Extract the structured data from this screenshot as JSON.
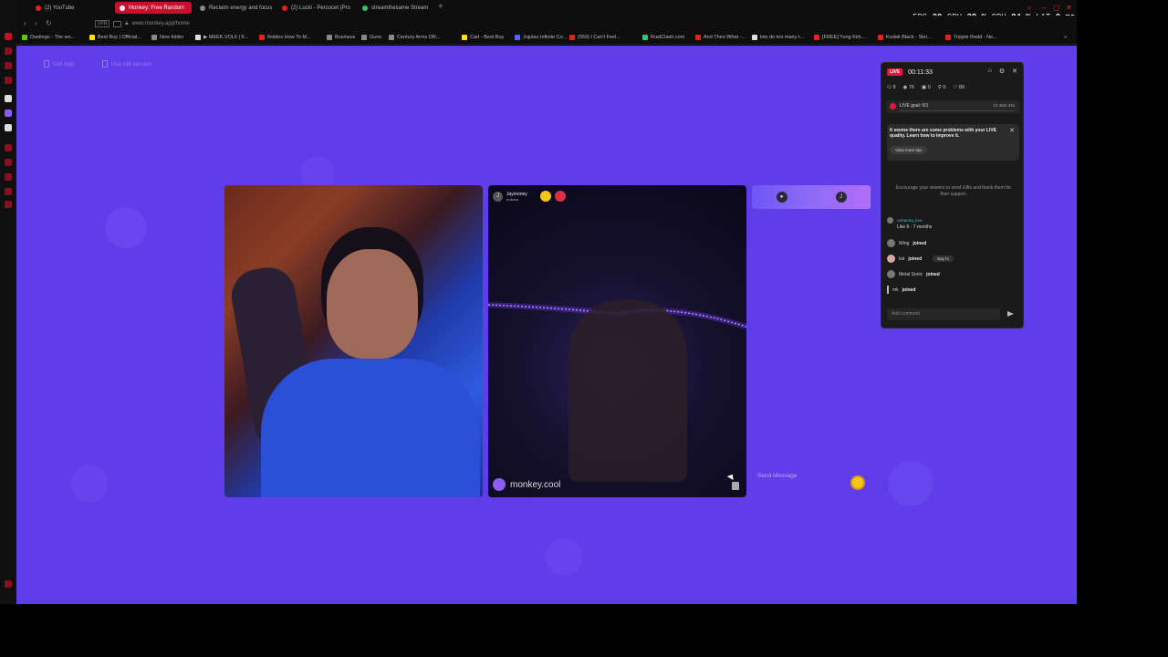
{
  "tabs": [
    {
      "label": "(2) YouTube",
      "active": false,
      "icon_color": "#e62117"
    },
    {
      "label": "Monkey: Free Random",
      "active": true,
      "icon_color": "#ffffff"
    },
    {
      "label": "Reclaim energy and focus",
      "active": false,
      "icon_color": "#888888"
    },
    {
      "label": "(2) Lucki - Percocet (Pro",
      "active": false,
      "icon_color": "#e62117"
    },
    {
      "label": "streamthesame Stream",
      "active": false,
      "icon_color": "#31c46a"
    }
  ],
  "hud": {
    "fps_label": "FPS",
    "fps": "30",
    "gpu_label": "GPU",
    "gpu": "38 %",
    "cpu_label": "CPU",
    "cpu": "24 %",
    "lat_label": "LAT",
    "lat": "0 ms"
  },
  "address": {
    "vpn": "VPN",
    "url": "www.monkey.app/home"
  },
  "bookmarks": [
    {
      "label": "Duolingo - The wo...",
      "color": "#58cc02"
    },
    {
      "label": "Best Buy | Official...",
      "color": "#ffe000"
    },
    {
      "label": "New folder",
      "color": "#888888"
    },
    {
      "label": "▶ MEEK.VOL6 | K...",
      "color": "#dddddd"
    },
    {
      "label": "Roblox How To M...",
      "color": "#e62117"
    },
    {
      "label": "Business",
      "color": "#888888"
    },
    {
      "label": "Guns",
      "color": "#888888"
    },
    {
      "label": "Century Arms DR...",
      "color": "#888888"
    },
    {
      "label": "Cart - Best Buy",
      "color": "#ffe000"
    },
    {
      "label": "Jujutsu Infinite Co...",
      "color": "#5865f2"
    },
    {
      "label": "(559) I Can't Feel...",
      "color": "#e62117"
    },
    {
      "label": "RustClash.com",
      "color": "#31c46a"
    },
    {
      "label": "And Then What -...",
      "color": "#e62117"
    },
    {
      "label": "lets do too many t...",
      "color": "#dddddd"
    },
    {
      "label": "[FREE] Yung Kirk...",
      "color": "#e62117"
    },
    {
      "label": "Kodak Black - Skri...",
      "color": "#e62117"
    },
    {
      "label": "Trippie Redd - Ne...",
      "color": "#e62117"
    }
  ],
  "topnav": {
    "get_app": "Get App",
    "old_version": "Use old version"
  },
  "stranger": {
    "name": "Jaymoney",
    "sub": "Indiana",
    "initial": "J"
  },
  "watermark": "monkey.cool",
  "chat": {
    "placeholder": "Send Message",
    "initial": "J"
  },
  "live": {
    "badge": "LIVE",
    "timer": "00:11:33",
    "stats": [
      {
        "icon": "users-icon",
        "value": "9"
      },
      {
        "icon": "eye-icon",
        "value": "76"
      },
      {
        "icon": "gift-icon",
        "value": "0"
      },
      {
        "icon": "share-icon",
        "value": "0"
      },
      {
        "icon": "heart-icon",
        "value": "89"
      }
    ],
    "goal": "LIVE goal: 0/1",
    "goal_time": "1h 48m 34s",
    "warning": "It seems there are some problems with your LIVE quality. Learn how to improve it.",
    "warning_button": "View more tips",
    "encourage": "Encourage your viewers to send Gifts and thank them for their support.",
    "feed": [
      {
        "name": "Ashanna_bco",
        "text": "Like 6 - 7 months",
        "joined": ""
      },
      {
        "name": "Wing",
        "text": "",
        "joined": "joined"
      },
      {
        "name": "kal",
        "text": "",
        "joined": "joined",
        "say_hi": "Say hi"
      },
      {
        "name": "Metal Sonic",
        "text": "",
        "joined": "joined"
      },
      {
        "name": "mk",
        "text": "",
        "joined": "joined"
      }
    ],
    "comment_placeholder": "Add comment"
  }
}
